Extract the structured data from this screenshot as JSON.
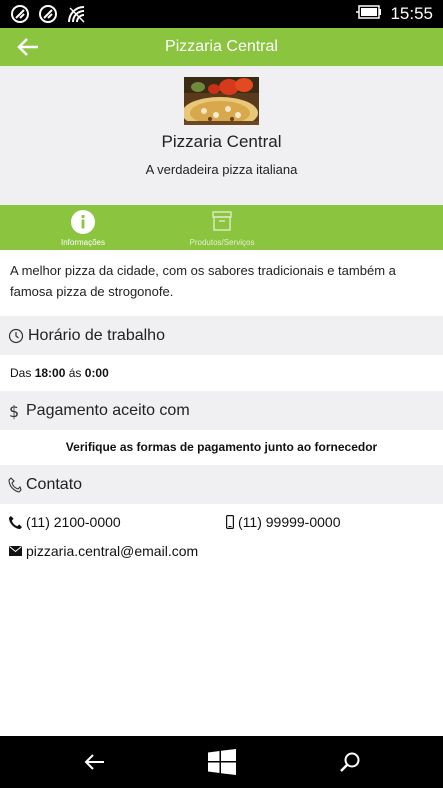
{
  "statusbar": {
    "time": "15:55"
  },
  "appbar": {
    "title": "Pizzaria Central"
  },
  "header": {
    "name": "Pizzaria Central",
    "tagline": "A verdadeira pizza italiana"
  },
  "tabs": [
    {
      "label": "Informações",
      "active": true
    },
    {
      "label": "Produtos/Serviços",
      "active": false
    }
  ],
  "description": "A melhor pizza da cidade, com os sabores tradicionais e também a famosa pizza de strogonofe.",
  "work_hours": {
    "title": "Horário de trabalho",
    "prefix": "Das",
    "from": "18:00",
    "mid": "ás",
    "to": "0:00"
  },
  "payment": {
    "title": "Pagamento aceito com",
    "text": "Verifique as formas de pagamento junto ao fornecedor"
  },
  "contact": {
    "title": "Contato",
    "phone": "(11) 2100-0000",
    "mobile": "(11) 99999-0000",
    "email": "pizzaria.central@email.com"
  },
  "colors": {
    "accent": "#8bc53f",
    "section_bg": "#f0eff1"
  }
}
